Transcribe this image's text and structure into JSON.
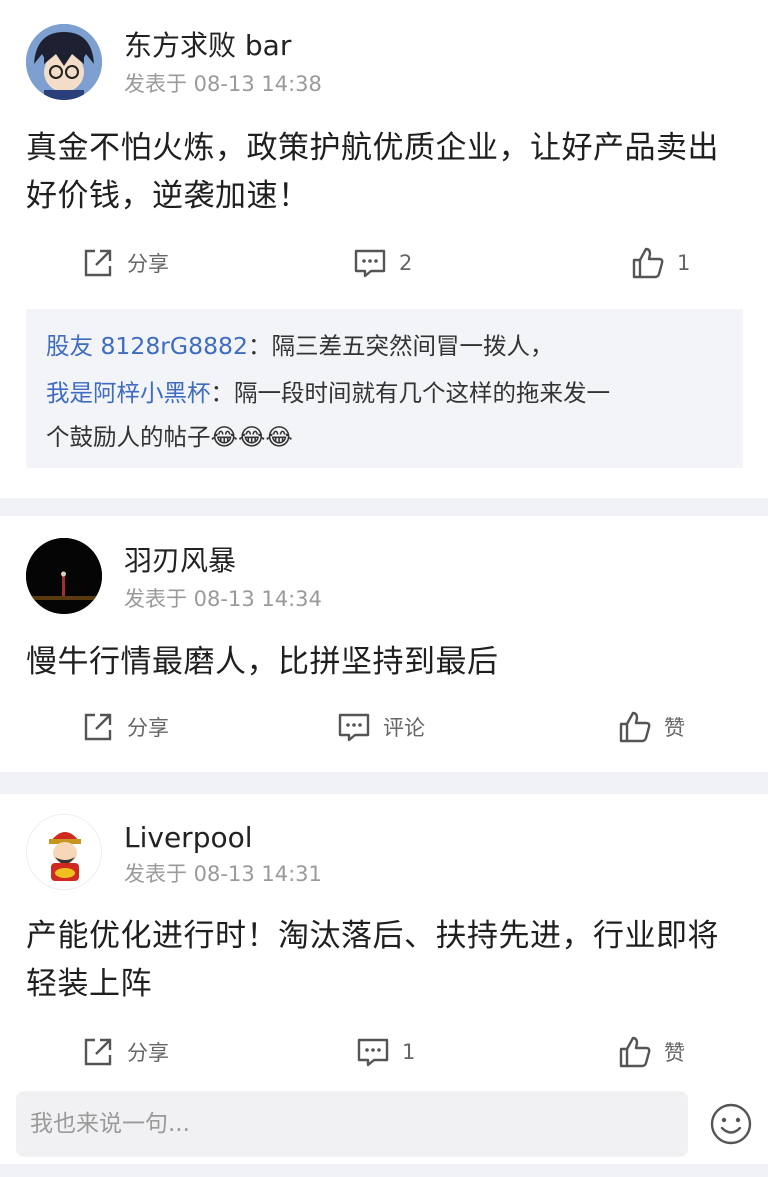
{
  "posts": [
    {
      "username": "东方求败 bar",
      "meta": "发表于 08-13 14:38",
      "content": "真金不怕火炼，政策护航优质企业，让好产品卖出好价钱，逆袭加速！",
      "share_label": "分享",
      "comment_label": "2",
      "like_label": "1"
    },
    {
      "username": "羽刃风暴",
      "meta": "发表于 08-13 14:34",
      "content": "慢牛行情最磨人，比拼坚持到最后",
      "share_label": "分享",
      "comment_label": "评论",
      "like_label": "赞"
    },
    {
      "username": "Liverpool",
      "meta": "发表于 08-13 14:31",
      "content": "产能优化进行时！淘汰落后、扶持先进，行业即将轻装上阵",
      "share_label": "分享",
      "comment_label": "1",
      "like_label": "赞"
    }
  ],
  "replies": [
    {
      "user": "股友 8128rG8882",
      "sep": "：",
      "text": "隔三差五突然间冒一拨人，"
    },
    {
      "user": "我是阿梓小黑杯",
      "sep": "：",
      "text": "隔一段时间就有几个这样的拖来发一",
      "text2": "个鼓励人的帖子😂😂😂"
    }
  ],
  "input": {
    "placeholder": "我也来说一句..."
  },
  "icons": [
    "share-icon",
    "comment-icon",
    "like-icon",
    "smile-icon"
  ],
  "colors": {
    "reply_user": "#3e6cc1",
    "meta": "#9a9a9a",
    "separator": "#f1f2f6"
  }
}
